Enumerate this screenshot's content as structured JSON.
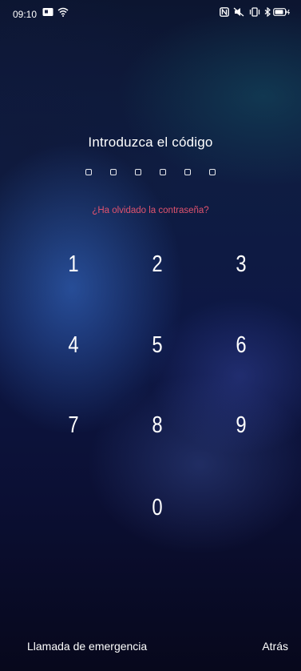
{
  "status_bar": {
    "time": "09:10",
    "left_icons": [
      "notification-icon",
      "wifi-icon"
    ],
    "right_icons": [
      "nfc-icon",
      "mute-icon",
      "vibrate-icon",
      "bluetooth-icon",
      "battery-icon"
    ]
  },
  "lock_screen": {
    "title": "Introduzca el código",
    "pin_length": 6,
    "forgot_password": "¿Ha olvidado la contraseña?",
    "forgot_color": "#e0536e",
    "keys": [
      "1",
      "2",
      "3",
      "4",
      "5",
      "6",
      "7",
      "8",
      "9",
      "0"
    ]
  },
  "footer": {
    "emergency_call": "Llamada de emergencia",
    "back": "Atrás"
  }
}
